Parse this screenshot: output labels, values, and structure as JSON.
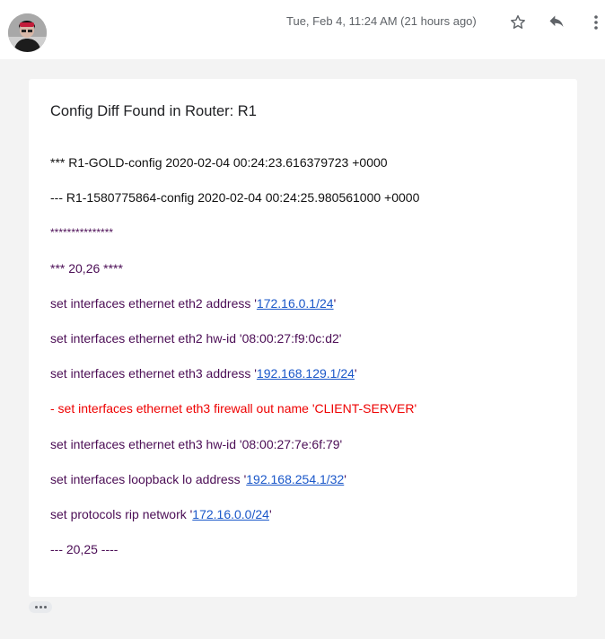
{
  "header": {
    "timestamp": "Tue, Feb 4, 11:24 AM (21 hours ago)",
    "icons": [
      "avatar",
      "star-icon",
      "reply-icon",
      "more-vert-icon"
    ]
  },
  "email": {
    "subject": "Config Diff Found in Router: R1",
    "lines": [
      {
        "text": "*** R1-GOLD-config 2020-02-04 00:24:23.616379723 +0000",
        "color": "#111111"
      },
      {
        "text": "--- R1-1580775864-config 2020-02-04 00:24:25.980561000 +0000",
        "color": "#111111"
      },
      {
        "text": "***************",
        "color": "#4b0d55"
      },
      {
        "text": "*** 20,26 ****",
        "color": "#4b0d55"
      },
      {
        "prefix": "set interfaces ethernet eth2 address '",
        "link": "172.16.0.1/24",
        "suffix": "'",
        "color": "#4b0d55"
      },
      {
        "text": "set interfaces ethernet eth2 hw-id '08:00:27:f9:0c:d2'",
        "color": "#4b0d55"
      },
      {
        "prefix": "set interfaces ethernet eth3 address '",
        "link": "192.168.129.1/24",
        "suffix": "'",
        "color": "#4b0d55"
      },
      {
        "text": "- set interfaces ethernet eth3 firewall out name 'CLIENT-SERVER'",
        "color": "#ee0000"
      },
      {
        "text": "set interfaces ethernet eth3 hw-id '08:00:27:7e:6f:79'",
        "color": "#4b0d55"
      },
      {
        "prefix": "set interfaces loopback lo address '",
        "link": "192.168.254.1/32",
        "suffix": "'",
        "color": "#4b0d55"
      },
      {
        "prefix": "set protocols rip network '",
        "link": "172.16.0.0/24",
        "suffix": "'",
        "color": "#4b0d55"
      },
      {
        "text": "--- 20,25 ----",
        "color": "#4b0d55"
      }
    ]
  },
  "colors": {
    "link": "#1a57c9",
    "background": "#f3f3f3",
    "card": "#ffffff"
  }
}
